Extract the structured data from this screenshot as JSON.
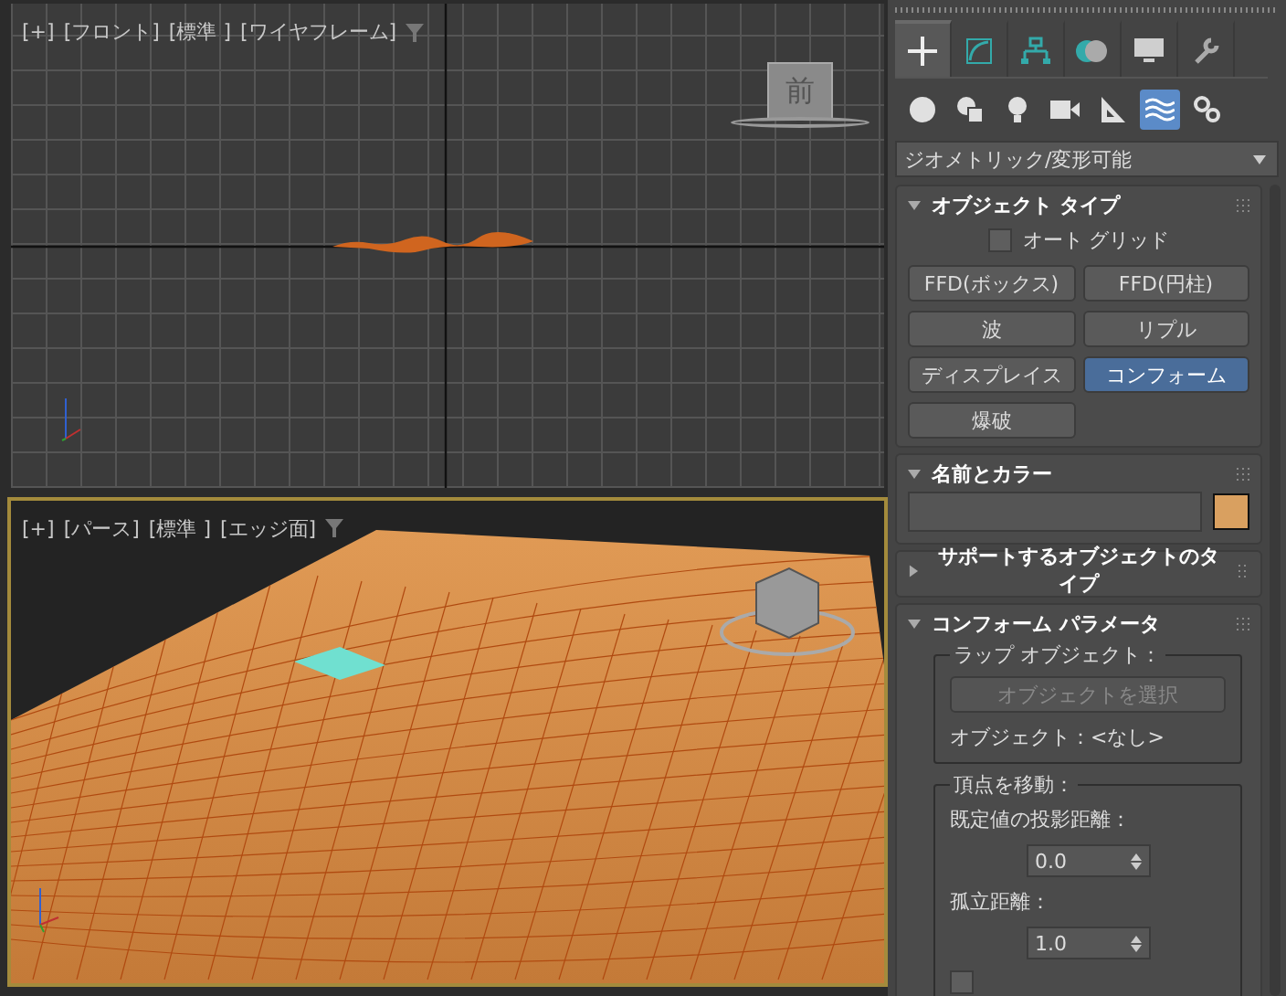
{
  "viewports": [
    {
      "kind": "front",
      "active": false,
      "labels": [
        "[+]",
        "[フロント]",
        "[標準 ]",
        "[ワイヤフレーム]"
      ],
      "viewcube_label": "前"
    },
    {
      "kind": "perspective",
      "active": true,
      "labels": [
        "[+]",
        "[パース]",
        "[標準 ]",
        "[エッジ面]"
      ]
    }
  ],
  "command_tabs": [
    {
      "kind": "create",
      "selected": true
    },
    {
      "kind": "modify",
      "selected": false
    },
    {
      "kind": "hierarchy",
      "selected": false
    },
    {
      "kind": "motion",
      "selected": false
    },
    {
      "kind": "display",
      "selected": false
    },
    {
      "kind": "utilities",
      "selected": false
    }
  ],
  "categories": [
    {
      "kind": "geometry",
      "selected": false
    },
    {
      "kind": "shapes",
      "selected": false
    },
    {
      "kind": "lights",
      "selected": false
    },
    {
      "kind": "cameras",
      "selected": false
    },
    {
      "kind": "helpers",
      "selected": false
    },
    {
      "kind": "spacewarps",
      "selected": true
    },
    {
      "kind": "systems",
      "selected": false
    }
  ],
  "dropdown": {
    "value": "ジオメトリック/変形可能"
  },
  "object_type": {
    "title": "オブジェクト タイプ",
    "expanded": true,
    "autogrid": {
      "label": "オート グリッド",
      "checked": false
    },
    "buttons": [
      {
        "label": "FFD(ボックス)",
        "selected": false
      },
      {
        "label": "FFD(円柱)",
        "selected": false
      },
      {
        "label": "波",
        "selected": false
      },
      {
        "label": "リプル",
        "selected": false
      },
      {
        "label": "ディスプレイス",
        "selected": false
      },
      {
        "label": "コンフォーム",
        "selected": true
      },
      {
        "label": "爆破",
        "selected": false
      }
    ]
  },
  "name_color": {
    "title": "名前とカラー",
    "expanded": true
  },
  "supported_types": {
    "title": "サポートするオブジェクトのタイプ",
    "expanded": false
  },
  "conform_params": {
    "title": "コンフォーム パラメータ",
    "expanded": true,
    "wrap_group": {
      "title": "ラップ オブジェクト：",
      "button": {
        "label": "オブジェクトを選択",
        "disabled": true
      },
      "object_label": "オブジェクト：<なし>"
    },
    "vertex_group": {
      "title": "頂点を移動：",
      "fields": [
        {
          "label": "既定値の投影距離：",
          "value": "0.0"
        },
        {
          "label": "孤立距離：",
          "value": "1.0"
        }
      ],
      "option": {
        "checked": false
      }
    }
  }
}
